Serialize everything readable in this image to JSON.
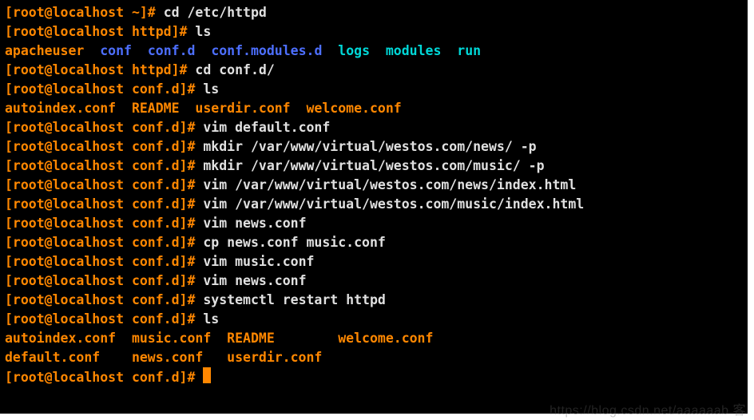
{
  "lines": [
    [
      {
        "cls": "orange",
        "key": "p_home"
      },
      {
        "cls": "white",
        "key": "cmd_cd_httpd"
      }
    ],
    [
      {
        "cls": "orange",
        "key": "p_httpd"
      },
      {
        "cls": "white",
        "key": "cmd_ls"
      }
    ],
    [
      {
        "cls": "orange",
        "key": "ls1_apacheuser"
      },
      {
        "cls": "blue",
        "key": "ls1_conf"
      },
      {
        "cls": "blue",
        "key": "ls1_confd"
      },
      {
        "cls": "blue",
        "key": "ls1_confmod"
      },
      {
        "cls": "cyan",
        "key": "ls1_logs"
      },
      {
        "cls": "cyan",
        "key": "ls1_modules"
      },
      {
        "cls": "cyan",
        "key": "ls1_run"
      }
    ],
    [
      {
        "cls": "orange",
        "key": "p_httpd"
      },
      {
        "cls": "white",
        "key": "cmd_cd_confd"
      }
    ],
    [
      {
        "cls": "orange",
        "key": "p_confd"
      },
      {
        "cls": "white",
        "key": "cmd_ls"
      }
    ],
    [
      {
        "cls": "orange",
        "key": "ls2"
      }
    ],
    [
      {
        "cls": "orange",
        "key": "p_confd"
      },
      {
        "cls": "white",
        "key": "cmd_vim_default"
      }
    ],
    [
      {
        "cls": "orange",
        "key": "p_confd"
      },
      {
        "cls": "white",
        "key": "cmd_mkdir_news"
      }
    ],
    [
      {
        "cls": "orange",
        "key": "p_confd"
      },
      {
        "cls": "white",
        "key": "cmd_mkdir_music"
      }
    ],
    [
      {
        "cls": "orange",
        "key": "p_confd"
      },
      {
        "cls": "white",
        "key": "cmd_vim_news_index"
      }
    ],
    [
      {
        "cls": "orange",
        "key": "p_confd"
      },
      {
        "cls": "white",
        "key": "cmd_vim_music_index"
      }
    ],
    [
      {
        "cls": "orange",
        "key": "p_confd"
      },
      {
        "cls": "white",
        "key": "cmd_vim_newsconf"
      }
    ],
    [
      {
        "cls": "orange",
        "key": "p_confd"
      },
      {
        "cls": "white",
        "key": "cmd_cp"
      }
    ],
    [
      {
        "cls": "orange",
        "key": "p_confd"
      },
      {
        "cls": "white",
        "key": "cmd_vim_musicconf"
      }
    ],
    [
      {
        "cls": "orange",
        "key": "p_confd"
      },
      {
        "cls": "white",
        "key": "cmd_vim_newsconf"
      }
    ],
    [
      {
        "cls": "orange",
        "key": "p_confd"
      },
      {
        "cls": "white",
        "key": "cmd_restart"
      }
    ],
    [
      {
        "cls": "orange",
        "key": "p_confd"
      },
      {
        "cls": "white",
        "key": "cmd_ls"
      }
    ],
    [
      {
        "cls": "orange",
        "key": "ls3_row1"
      }
    ],
    [
      {
        "cls": "orange",
        "key": "ls3_row2"
      }
    ],
    [
      {
        "cls": "orange",
        "key": "p_confd"
      },
      {
        "cls": "white",
        "key": "space"
      },
      {
        "cls": "cursor",
        "cursor": true
      }
    ]
  ],
  "text": {
    "p_home": "[root@localhost ~]# ",
    "p_httpd": "[root@localhost httpd]# ",
    "p_confd": "[root@localhost conf.d]# ",
    "cmd_cd_httpd": "cd /etc/httpd",
    "cmd_ls": "ls",
    "ls1_apacheuser": "apacheuser  ",
    "ls1_conf": "conf  ",
    "ls1_confd": "conf.d  ",
    "ls1_confmod": "conf.modules.d  ",
    "ls1_logs": "logs  ",
    "ls1_modules": "modules  ",
    "ls1_run": "run",
    "cmd_cd_confd": "cd conf.d/",
    "ls2": "autoindex.conf  README  userdir.conf  welcome.conf",
    "cmd_vim_default": "vim default.conf",
    "cmd_mkdir_news": "mkdir /var/www/virtual/westos.com/news/ -p",
    "cmd_mkdir_music": "mkdir /var/www/virtual/westos.com/music/ -p",
    "cmd_vim_news_index": "vim /var/www/virtual/westos.com/news/index.html",
    "cmd_vim_music_index": "vim /var/www/virtual/westos.com/music/index.html",
    "cmd_vim_newsconf": "vim news.conf",
    "cmd_cp": "cp news.conf music.conf",
    "cmd_vim_musicconf": "vim music.conf",
    "cmd_restart": "systemctl restart httpd",
    "ls3_row1": "autoindex.conf  music.conf  README        welcome.conf",
    "ls3_row2": "default.conf    news.conf   userdir.conf",
    "space": ""
  },
  "watermark": "https://blog.csdn.net/aaaaaab 客"
}
